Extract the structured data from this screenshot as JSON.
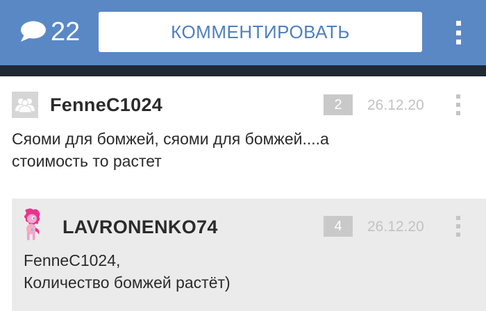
{
  "header": {
    "comment_count": "22",
    "comment_button_label": "КОММЕНТИРОВАТЬ",
    "colors": {
      "bar": "#5a88c5",
      "strip": "#1f2a35"
    }
  },
  "comments": [
    {
      "username": "FenneC1024",
      "rating": "2",
      "date": "26.12.20",
      "text_line1": "Сяоми для бомжей, сяоми для бомжей....а",
      "text_line2": "стоимость то растет",
      "avatar": "group-icon"
    },
    {
      "username": "LAVRONENKO74",
      "rating": "4",
      "date": "26.12.20",
      "text_line1": "FenneC1024,",
      "text_line2": "Количество бомжей растёт)",
      "avatar": "pony-avatar"
    }
  ]
}
